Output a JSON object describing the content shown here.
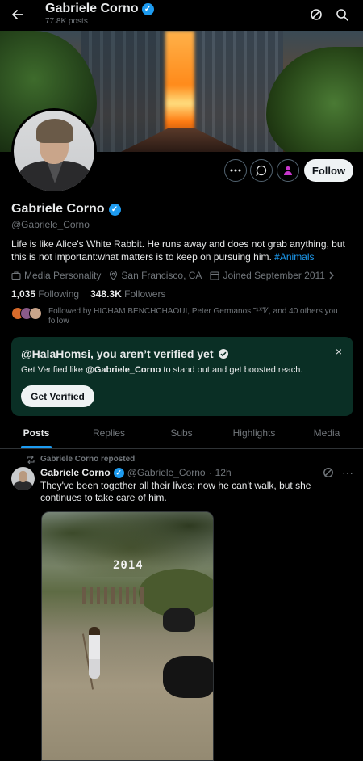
{
  "header": {
    "name": "Gabriele Corno",
    "posts_count": "77.8K posts",
    "back_icon": "arrow-left-icon",
    "right_icons": [
      "grok-icon",
      "search-icon"
    ]
  },
  "profile": {
    "name": "Gabriele Corno",
    "handle": "@Gabriele_Corno",
    "bio_text": "Life is like Alice's White Rabbit. He runs away and does not grab anything, but this is not important:what matters is to keep on pursuing him.",
    "bio_hashtag": "#Animals",
    "category": "Media Personality",
    "location": "San Francisco, CA",
    "joined": "Joined September 2011",
    "following_count": "1,035",
    "following_label": "Following",
    "followers_count": "348.3K",
    "followers_label": "Followers",
    "followed_by": "Followed by HICHAM BENCHCHAOUI, Peter Germanos ˜¹ᕁᏤ, and 40 others you follow",
    "follow_label": "Follow"
  },
  "verify_card": {
    "title": "@HalaHomsi, you aren’t verified yet",
    "text_prefix": "Get Verified like ",
    "text_handle": "@Gabriele_Corno",
    "text_suffix": " to stand out and get boosted reach.",
    "button": "Get Verified",
    "close": "×"
  },
  "tabs": [
    "Posts",
    "Replies",
    "Subs",
    "Highlights",
    "Media"
  ],
  "active_tab": "Posts",
  "post": {
    "repost_label": "Gabriele Corno reposted",
    "author": "Gabriele Corno",
    "handle": "@Gabriele_Corno",
    "dot": "·",
    "time": "12h",
    "text": "They've been together all their lives; now he can't walk, but she continues to take care of him.",
    "media_overlay": "2014",
    "more": "···"
  },
  "colors": {
    "accent": "#1d9bf0",
    "background": "#000000",
    "verify_card_bg": "#0a2f25",
    "muted": "#71767b"
  }
}
